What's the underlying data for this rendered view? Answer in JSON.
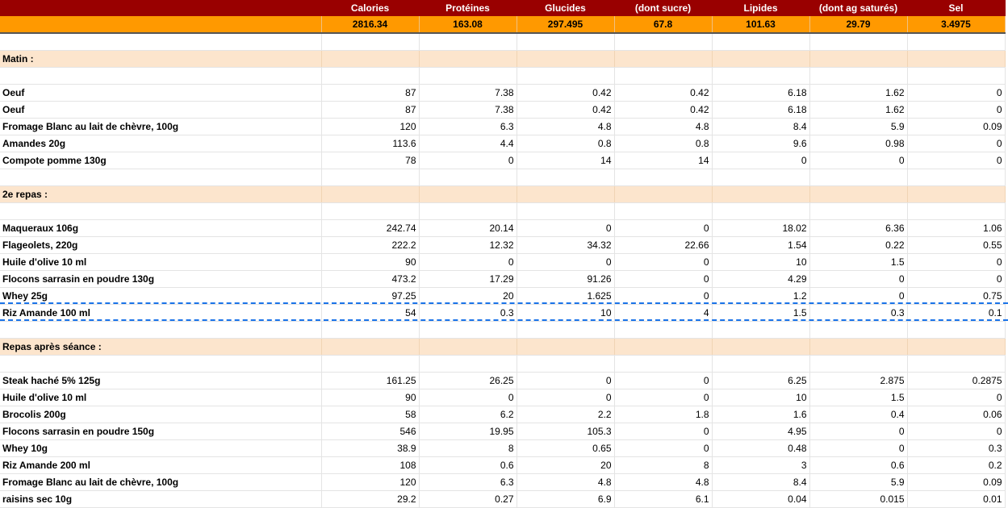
{
  "columns": [
    "",
    "Calories",
    "Protéines",
    "Glucides",
    "(dont sucre)",
    "Lipides",
    "(dont ag saturés)",
    "Sel"
  ],
  "totals": [
    "",
    "2816.34",
    "163.08",
    "297.495",
    "67.8",
    "101.63",
    "29.79",
    "3.4975"
  ],
  "sections": [
    {
      "title": "Matin :",
      "rows": [
        [
          "Oeuf",
          "87",
          "7.38",
          "0.42",
          "0.42",
          "6.18",
          "1.62",
          "0"
        ],
        [
          "Oeuf",
          "87",
          "7.38",
          "0.42",
          "0.42",
          "6.18",
          "1.62",
          "0"
        ],
        [
          "Fromage Blanc au lait de chèvre, 100g",
          "120",
          "6.3",
          "4.8",
          "4.8",
          "8.4",
          "5.9",
          "0.09"
        ],
        [
          "Amandes  20g",
          "113.6",
          "4.4",
          "0.8",
          "0.8",
          "9.6",
          "0.98",
          "0"
        ],
        [
          "Compote pomme 130g",
          "78",
          "0",
          "14",
          "14",
          "0",
          "0",
          "0"
        ]
      ]
    },
    {
      "title": "2e repas :",
      "rows": [
        [
          "Maqueraux 106g",
          "242.74",
          "20.14",
          "0",
          "0",
          "18.02",
          "6.36",
          "1.06"
        ],
        [
          "Flageolets, 220g",
          "222.2",
          "12.32",
          "34.32",
          "22.66",
          "1.54",
          "0.22",
          "0.55"
        ],
        [
          "Huile d'olive 10 ml",
          "90",
          "0",
          "0",
          "0",
          "10",
          "1.5",
          "0"
        ],
        [
          "Flocons sarrasin en poudre 130g",
          "473.2",
          "17.29",
          "91.26",
          "0",
          "4.29",
          "0",
          "0"
        ],
        [
          "Whey 25g",
          "97.25",
          "20",
          "1.625",
          "0",
          "1.2",
          "0",
          "0.75"
        ],
        [
          "Riz Amande 100 ml",
          "54",
          "0.3",
          "10",
          "4",
          "1.5",
          "0.3",
          "0.1"
        ]
      ]
    },
    {
      "title": "Repas après séance :",
      "rows": [
        [
          "Steak haché 5% 125g",
          "161.25",
          "26.25",
          "0",
          "0",
          "6.25",
          "2.875",
          "0.2875"
        ],
        [
          "Huile d'olive 10 ml",
          "90",
          "0",
          "0",
          "0",
          "10",
          "1.5",
          "0"
        ],
        [
          "Brocolis 200g",
          "58",
          "6.2",
          "2.2",
          "1.8",
          "1.6",
          "0.4",
          "0.06"
        ],
        [
          "Flocons sarrasin en poudre 150g",
          "546",
          "19.95",
          "105.3",
          "0",
          "4.95",
          "0",
          "0"
        ],
        [
          "Whey 10g",
          "38.9",
          "8",
          "0.65",
          "0",
          "0.48",
          "0",
          "0.3"
        ],
        [
          "Riz Amande 200 ml",
          "108",
          "0.6",
          "20",
          "8",
          "3",
          "0.6",
          "0.2"
        ],
        [
          "Fromage Blanc au lait de chèvre, 100g",
          "120",
          "6.3",
          "4.8",
          "4.8",
          "8.4",
          "5.9",
          "0.09"
        ],
        [
          "raisins sec 10g",
          "29.2",
          "0.27",
          "6.9",
          "6.1",
          "0.04",
          "0.015",
          "0.01"
        ]
      ]
    }
  ],
  "colors": {
    "header_bg": "#990000",
    "totals_bg": "#ff9900",
    "section_bg": "#fce5cd",
    "selection": "#1a73e8"
  }
}
